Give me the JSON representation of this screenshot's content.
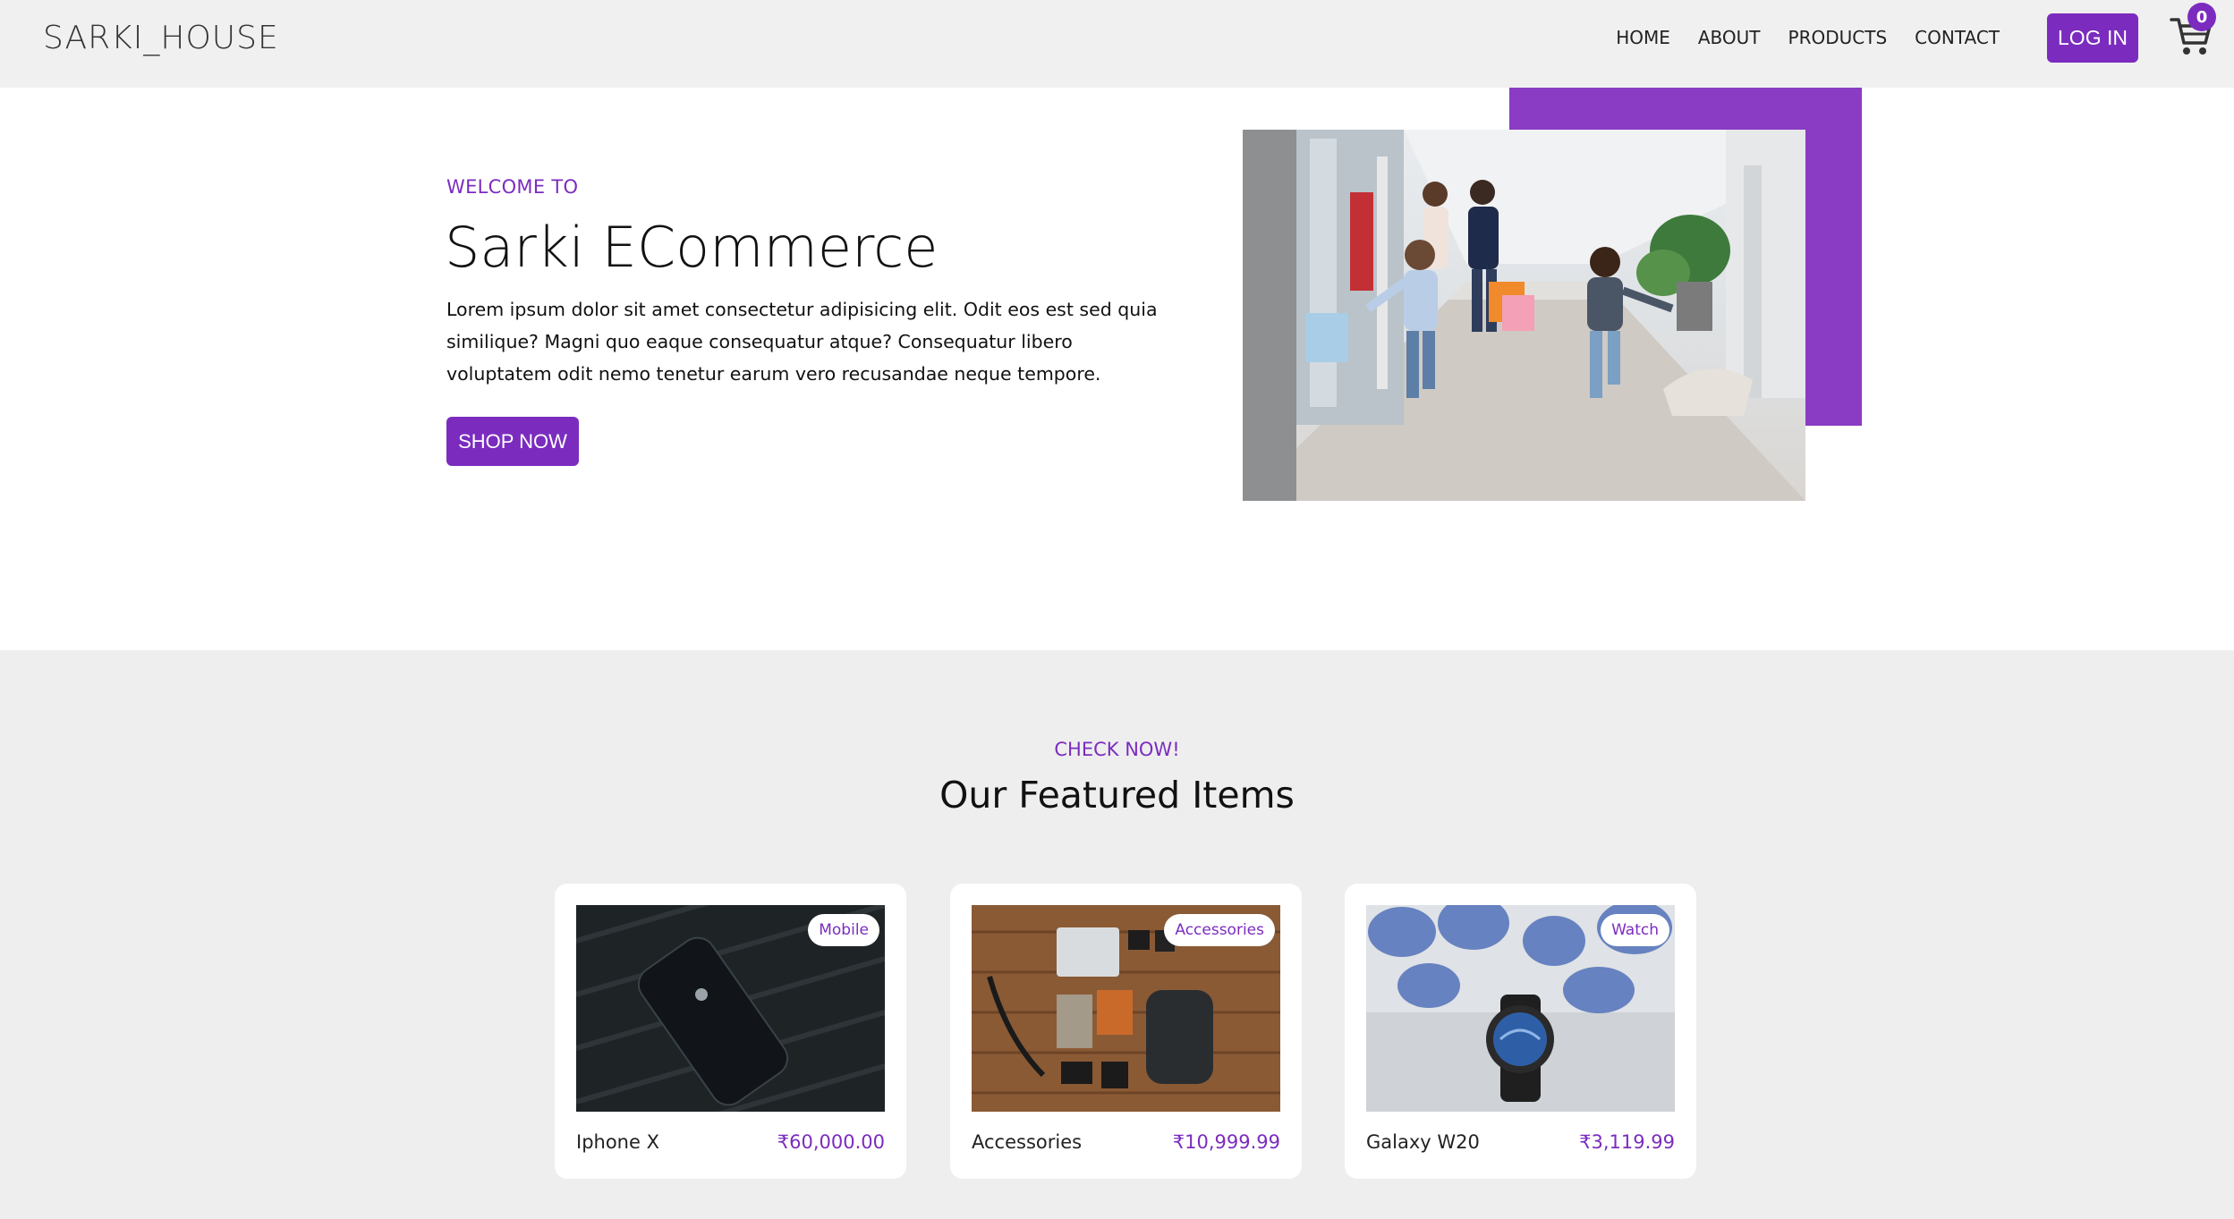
{
  "brand": "SARKI_HOUSE",
  "nav": {
    "links": [
      "HOME",
      "ABOUT",
      "PRODUCTS",
      "CONTACT"
    ],
    "login_label": "LOG IN",
    "cart_count": "0"
  },
  "hero": {
    "eyebrow": "WELCOME TO",
    "title": "Sarki ECommerce",
    "text": "Lorem ipsum dolor sit amet consectetur adipisicing elit. Odit eos est sed quia similique? Magni quo eaque consequatur atque? Consequatur libero voluptatem odit nemo tenetur earum vero recusandae neque tempore.",
    "cta_label": "SHOP NOW"
  },
  "featured": {
    "eyebrow": "CHECK NOW!",
    "title": "Our Featured Items",
    "items": [
      {
        "tag": "Mobile",
        "name": "Iphone X",
        "price": "₹60,000.00"
      },
      {
        "tag": "Accessories",
        "name": "Accessories",
        "price": "₹10,999.99"
      },
      {
        "tag": "Watch",
        "name": "Galaxy W20",
        "price": "₹3,119.99"
      }
    ]
  },
  "colors": {
    "accent": "#7b2cbf",
    "nav_bg": "#f0f0f0",
    "section_bg": "#eeeeee"
  }
}
